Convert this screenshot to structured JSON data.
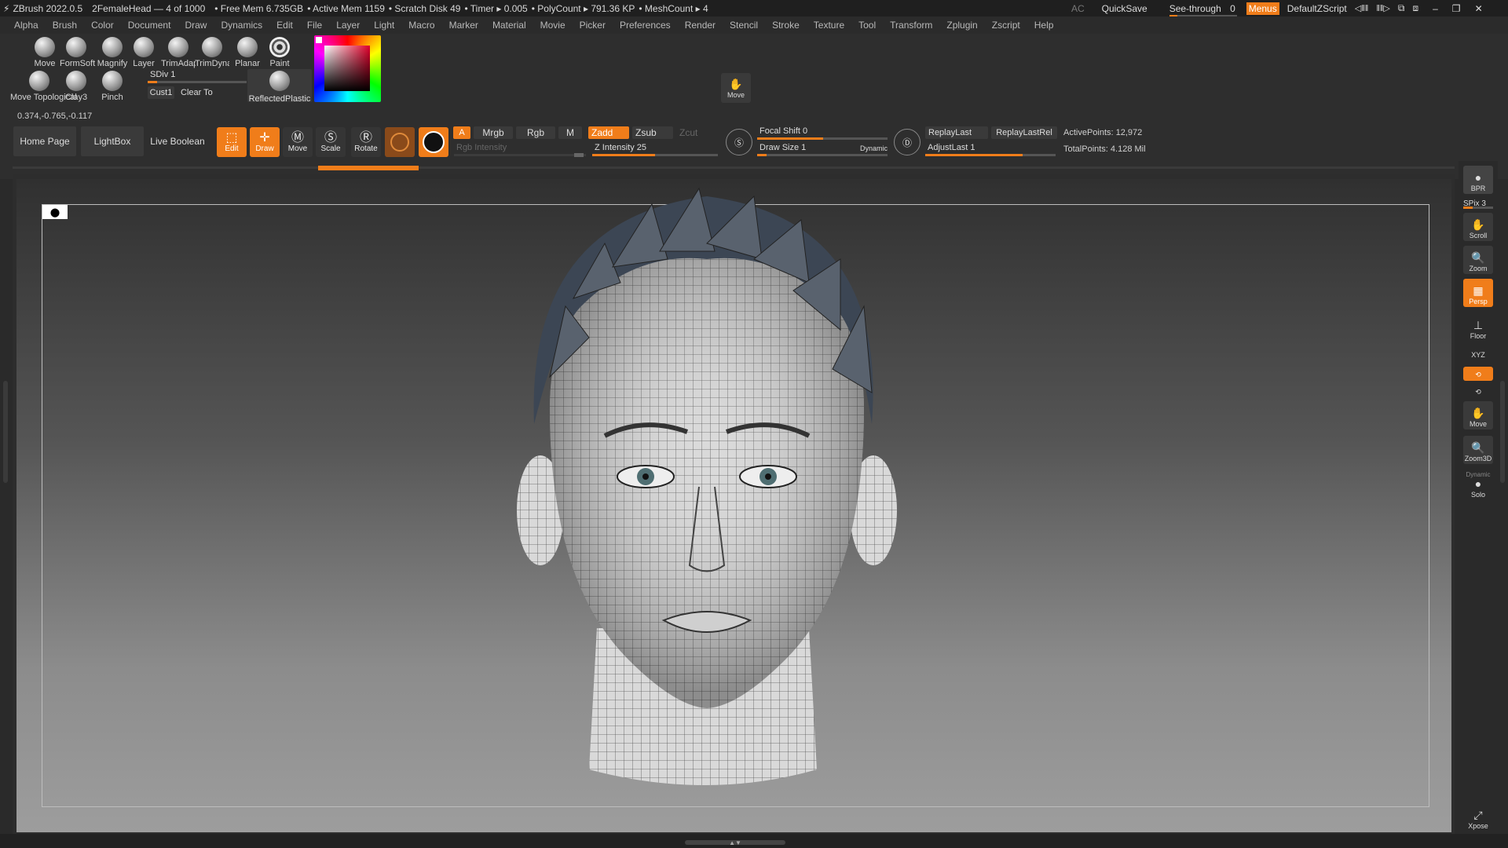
{
  "titlebar": {
    "app": "ZBrush 2022.0.5",
    "doc": "2FemaleHead — 4 of 1000",
    "free_mem": "• Free Mem 6.735GB",
    "active_mem": "• Active Mem 1159",
    "scratch_disk": "• Scratch Disk 49",
    "timer": "• Timer ▸ 0.005",
    "polycount": "• PolyCount ▸ 791.36 KP",
    "meshcount": "• MeshCount ▸ 4",
    "ac": "AC",
    "quicksave": "QuickSave",
    "see_through_label": "See-through",
    "see_through_value": "0",
    "menus": "Menus",
    "default_zscript": "DefaultZScript"
  },
  "menubar": [
    "Alpha",
    "Brush",
    "Color",
    "Document",
    "Draw",
    "Dynamics",
    "Edit",
    "File",
    "Layer",
    "Light",
    "Macro",
    "Marker",
    "Material",
    "Movie",
    "Picker",
    "Preferences",
    "Render",
    "Stencil",
    "Stroke",
    "Texture",
    "Tool",
    "Transform",
    "Zplugin",
    "Zscript",
    "Help"
  ],
  "brushes_row1": [
    "Move",
    "FormSoft",
    "Magnify",
    "Layer",
    "TrimAdaptive",
    "TrimDynamic",
    "Planar",
    "Paint"
  ],
  "brushes_row2": [
    "Move Topological",
    "Clay3",
    "Pinch"
  ],
  "sdiv": "SDiv 1",
  "cust": "Cust1",
  "clear_to": "Clear To",
  "material": "ReflectedPlastic",
  "move_tool": "Move",
  "coords": "0.374,-0.765,-0.117",
  "tabs": {
    "home": "Home Page",
    "lightbox": "LightBox",
    "live_boolean": "Live Boolean"
  },
  "tools": {
    "edit": "Edit",
    "draw": "Draw",
    "move": "Move",
    "scale": "Scale",
    "rotate": "Rotate"
  },
  "color_modes": {
    "a": "A",
    "mrgb": "Mrgb",
    "rgb": "Rgb",
    "m": "M",
    "rgb_intensity": "Rgb Intensity"
  },
  "z_modes": {
    "zadd": "Zadd",
    "zsub": "Zsub",
    "zcut": "Zcut",
    "z_intensity": "Z Intensity 25"
  },
  "focal_shift": "Focal Shift 0",
  "draw_size": "Draw Size 1",
  "dynamic": "Dynamic",
  "replay_last": "ReplayLast",
  "replay_last_rel": "ReplayLastRel",
  "adjust_last": "AdjustLast 1",
  "active_points": "ActivePoints: 12,972",
  "total_points": "TotalPoints: 4.128 Mil",
  "right_tray": {
    "bpr": "BPR",
    "spix": "SPix 3",
    "scroll": "Scroll",
    "zoom": "Zoom",
    "persp": "Persp",
    "floor": "Floor",
    "xyz": "XYZ",
    "move": "Move",
    "zoom3d": "Zoom3D",
    "dynamic": "Dynamic",
    "solo": "Solo",
    "xpose": "Xpose"
  },
  "accent_color": "#f07d1a"
}
